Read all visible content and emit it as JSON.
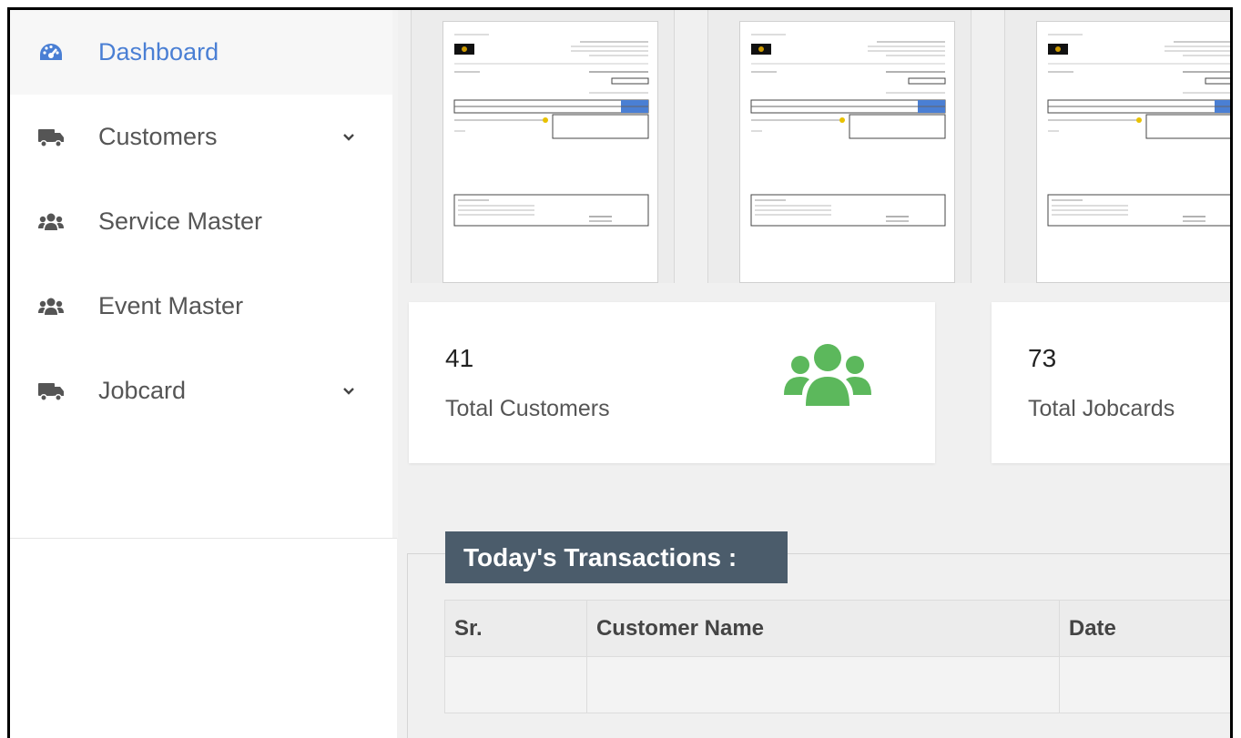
{
  "sidebar": {
    "items": [
      {
        "label": "Dashboard",
        "icon": "tachometer-icon",
        "active": true,
        "has_dropdown": false
      },
      {
        "label": "Customers",
        "icon": "truck-icon",
        "active": false,
        "has_dropdown": true
      },
      {
        "label": "Service Master",
        "icon": "users-icon",
        "active": false,
        "has_dropdown": false
      },
      {
        "label": "Event Master",
        "icon": "users-icon",
        "active": false,
        "has_dropdown": false
      },
      {
        "label": "Jobcard",
        "icon": "truck-icon",
        "active": false,
        "has_dropdown": true
      }
    ]
  },
  "stats": [
    {
      "count": "41",
      "label": "Total Customers",
      "icon": "users-icon",
      "icon_color": "#5cb85c"
    },
    {
      "count": "73",
      "label": "Total Jobcards"
    }
  ],
  "transactions": {
    "title": "Today's Transactions :",
    "columns": [
      "Sr.",
      "Customer Name",
      "Date"
    ]
  },
  "colors": {
    "accent": "#4a7fd4",
    "section_header": "#4b5c6b",
    "stat_icon": "#5cb85c"
  }
}
